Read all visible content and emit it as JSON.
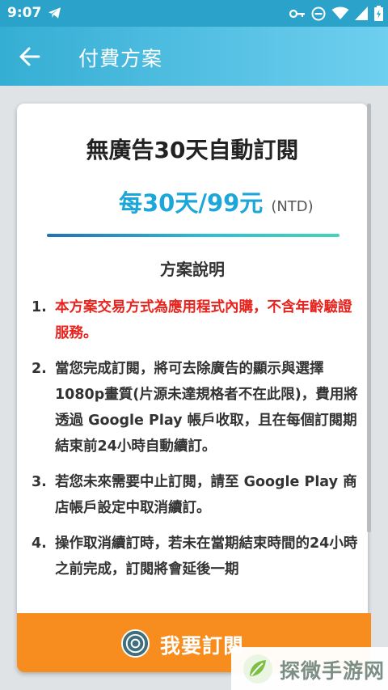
{
  "status_bar": {
    "time": "9:07",
    "icons": [
      "telegram-icon",
      "key-icon",
      "do-not-disturb-icon",
      "wifi-icon",
      "signal-icon",
      "battery-icon"
    ]
  },
  "app_bar": {
    "title": "付費方案",
    "back_icon": "arrow-left-icon"
  },
  "plan": {
    "title": "無廣告30天自動訂閱",
    "price": "每30天/99元",
    "currency": "(NTD)"
  },
  "description": {
    "title": "方案說明",
    "items": [
      {
        "num": "1.",
        "text": "本方案交易方式為應用程式內購，不含年齡驗證服務。"
      },
      {
        "num": "2.",
        "text": "當您完成訂閱，將可去除廣告的顯示與選擇1080p畫質(片源未達規格者不在此限)，費用將透過 Google Play 帳戶收取，且在每個訂閱期結束前24小時自動續訂。"
      },
      {
        "num": "3.",
        "text": "若您未來需要中止訂閱，請至 Google Play 商店帳戶設定中取消續訂。"
      },
      {
        "num": "4.",
        "text": "操作取消續訂時，若未在當期結束時間的24小時之前完成，訂閱將會延後一期"
      }
    ]
  },
  "subscribe_button": {
    "label": "我要訂閱"
  },
  "watermark": {
    "text": "探微手游网"
  },
  "colors": {
    "status_bar": "#2aa2c9",
    "app_bar": "#4dbfe3",
    "price": "#1da6d8",
    "warning": "#e8231d",
    "button": "#f78d1f"
  }
}
